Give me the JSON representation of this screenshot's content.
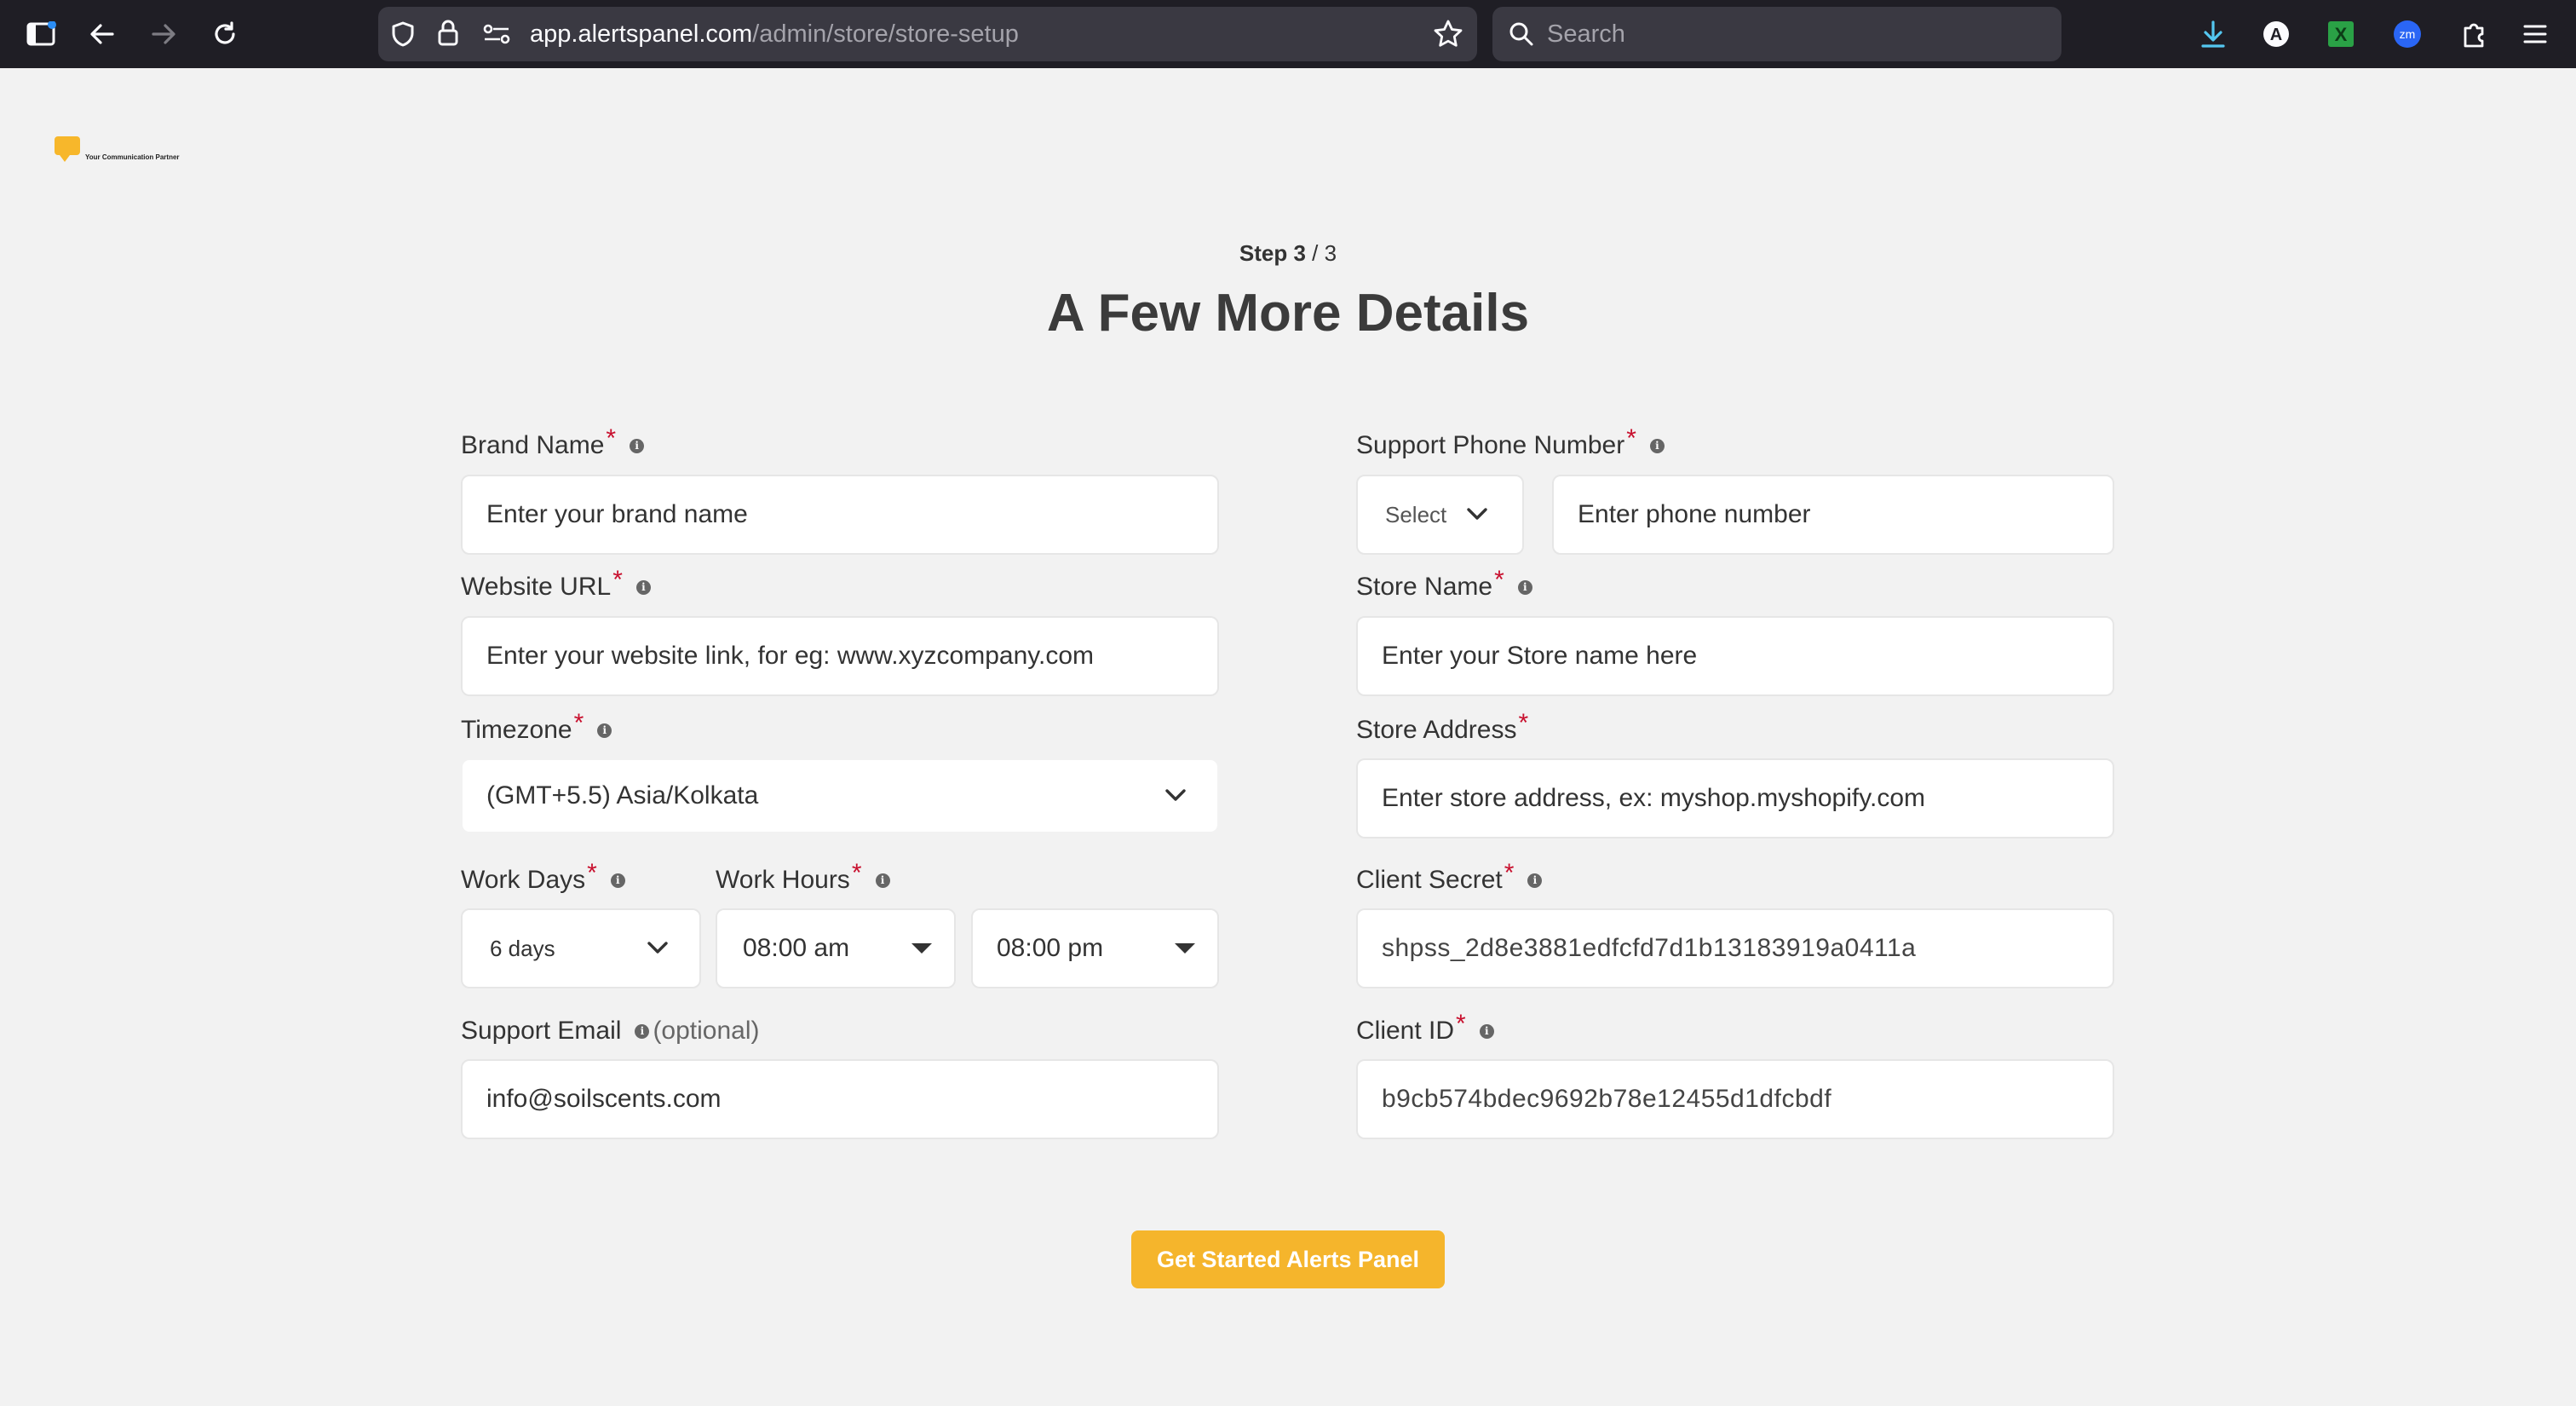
{
  "browser": {
    "url_host": "app.alertspanel.com",
    "url_path": "/admin/store/store-setup",
    "search_placeholder": "Search",
    "zoom_badge": "zm"
  },
  "logo": {
    "tagline": "Your Communication Partner",
    "color": "#f7b72b"
  },
  "header": {
    "step_current": "Step 3",
    "step_total": " / 3",
    "title": "A Few More Details"
  },
  "form": {
    "brand_name": {
      "label": "Brand Name",
      "placeholder": "Enter your brand name"
    },
    "website_url": {
      "label": "Website URL",
      "placeholder": "Enter your website link, for eg: www.xyzcompany.com"
    },
    "timezone": {
      "label": "Timezone",
      "value": "(GMT+5.5) Asia/Kolkata"
    },
    "work_days": {
      "label": "Work Days",
      "value": "6 days"
    },
    "work_hours": {
      "label": "Work Hours",
      "start": "08:00 am",
      "end": "08:00 pm"
    },
    "support_email": {
      "label": "Support Email",
      "optional": "(optional)",
      "value": "info@soilscents.com"
    },
    "support_phone": {
      "label": "Support Phone Number",
      "code_value": "Select",
      "placeholder": "Enter phone number"
    },
    "store_name": {
      "label": "Store Name",
      "placeholder": "Enter your Store name here"
    },
    "store_address": {
      "label": "Store Address",
      "placeholder": "Enter store address, ex: myshop.myshopify.com"
    },
    "client_secret": {
      "label": "Client Secret",
      "value": "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"
    },
    "client_id": {
      "label": "Client ID",
      "value": "b9cb574bdec9692b78e12455d1dfcbdf"
    },
    "required_mark": "*",
    "info_glyph": "i"
  },
  "submit": {
    "label": "Get Started Alerts Panel",
    "color": "#f5b52c"
  }
}
